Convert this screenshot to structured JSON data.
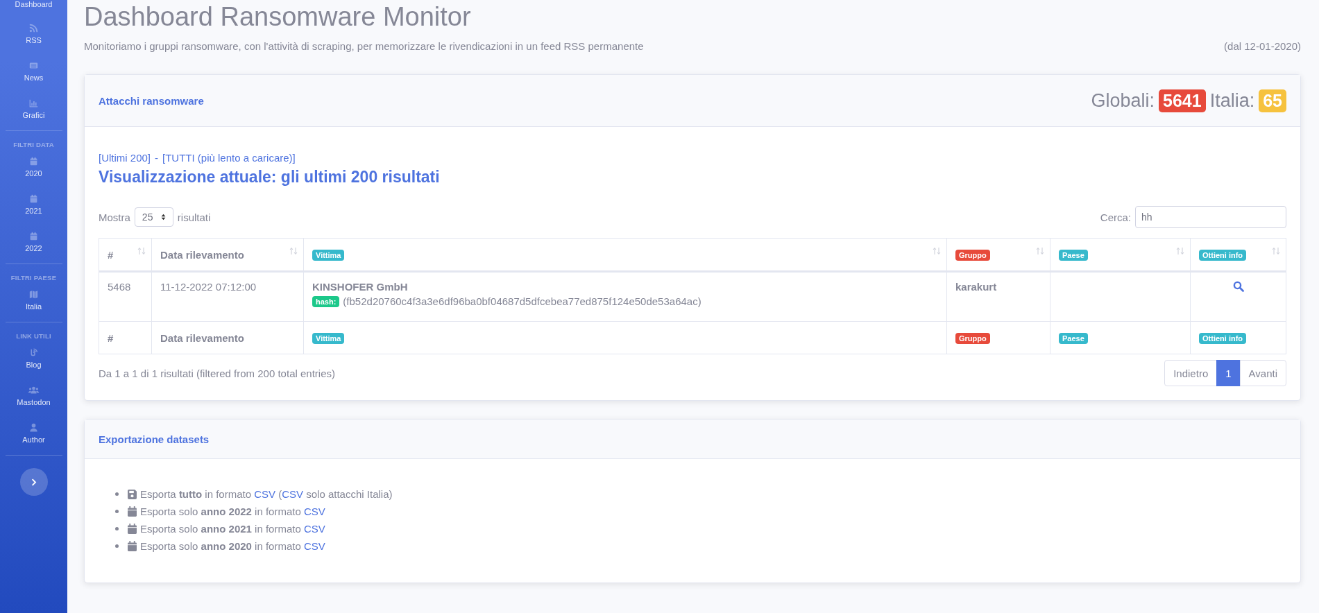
{
  "sidebar": {
    "sections": [
      {
        "items": [
          {
            "label": "Dashboard"
          },
          {
            "label": "RSS",
            "kind": "rss"
          },
          {
            "label": "News",
            "kind": "news"
          },
          {
            "label": "Grafici",
            "kind": "chart"
          }
        ]
      },
      {
        "heading": "FILTRI DATA",
        "items": [
          {
            "label": "2020",
            "kind": "calendar"
          },
          {
            "label": "2021",
            "kind": "calendar"
          },
          {
            "label": "2022",
            "kind": "calendar"
          }
        ]
      },
      {
        "heading": "FILTRI PAESE",
        "items": [
          {
            "label": "Italia",
            "kind": "map"
          }
        ]
      },
      {
        "heading": "LINK UTILI",
        "items": [
          {
            "label": "Blog",
            "kind": "blog"
          },
          {
            "label": "Mastodon",
            "kind": "users"
          },
          {
            "label": "Author",
            "kind": "user"
          }
        ]
      }
    ]
  },
  "page": {
    "title": "Dashboard Ransomware Monitor",
    "subtitle": "Monitoriamo i gruppi ransomware, con l'attività di scraping, per memorizzare le rivendicazioni in un feed RSS permanente",
    "since": "(dal 12-01-2020)"
  },
  "attacks_card": {
    "title": "Attacchi ransomware",
    "counters": [
      {
        "label": "Globali:",
        "value": "5641",
        "color": "#e74a3b"
      },
      {
        "label": "Italia:",
        "value": "65",
        "color": "#f6c23e"
      }
    ],
    "view_links": [
      "[Ultimi 200]",
      "[TUTTI (più lento a caricare)]"
    ],
    "view_links_separator": "-",
    "view_heading": "Visualizzazione attuale: gli ultimi 200 risultati",
    "length": {
      "before": "Mostra",
      "value": "25",
      "after": "risultati"
    },
    "search": {
      "label": "Cerca:",
      "value": "hh"
    },
    "table": {
      "columns": [
        {
          "label": "#",
          "kind": "text"
        },
        {
          "label": "Data rilevamento",
          "kind": "text"
        },
        {
          "label": "Vittima",
          "kind": "badge",
          "color": "#36b9cc"
        },
        {
          "label": "Gruppo",
          "kind": "badge",
          "color": "#e74a3b"
        },
        {
          "label": "Paese",
          "kind": "badge",
          "color": "#36b9cc"
        },
        {
          "label": "Ottieni info",
          "kind": "badge",
          "color": "#36b9cc"
        }
      ],
      "footer_columns": [
        {
          "label": "#",
          "kind": "text"
        },
        {
          "label": "Data rilevamento",
          "kind": "text"
        },
        {
          "label": "Vittima",
          "kind": "badge",
          "color": "#36b9cc"
        },
        {
          "label": "Gruppo",
          "kind": "badge",
          "color": "#e74a3b"
        },
        {
          "label": "Paese",
          "kind": "badge",
          "color": "#36b9cc"
        },
        {
          "label": "Ottieni info",
          "kind": "badge",
          "color": "#36b9cc"
        }
      ],
      "rows": [
        {
          "id": "5468",
          "date": "11-12-2022 07:12:00",
          "victim": "KINSHOFER GmbH",
          "hash_label": "hash:",
          "hash": "(fb52d20760c4f3a3e6df96ba0bf04687d5dfcebea77ed875f124e50de53a64ac)",
          "group": "karakurt"
        }
      ]
    },
    "info": "Da 1 a 1 di 1 risultati (filtered from 200 total entries)",
    "pages": [
      {
        "label": "Indietro",
        "selected": false
      },
      {
        "label": "1",
        "selected": true
      },
      {
        "label": "Avanti",
        "selected": false
      }
    ]
  },
  "export_card": {
    "title": "Exportazione datasets",
    "items": [
      {
        "kind": "save",
        "parts": [
          {
            "kind": "text",
            "text": "Esporta **tutto** in formato "
          },
          {
            "kind": "link",
            "text": "CSV"
          },
          {
            "kind": "text",
            "text": " ("
          },
          {
            "kind": "link",
            "text": "CSV"
          },
          {
            "kind": "text",
            "text": " solo attacchi Italia)"
          }
        ]
      },
      {
        "kind": "calendar",
        "parts": [
          {
            "kind": "text",
            "text": "Esporta solo **anno 2022** in formato "
          },
          {
            "kind": "link",
            "text": "CSV"
          }
        ]
      },
      {
        "kind": "calendar",
        "parts": [
          {
            "kind": "text",
            "text": "Esporta solo **anno 2021** in formato "
          },
          {
            "kind": "link",
            "text": "CSV"
          }
        ]
      },
      {
        "kind": "calendar",
        "parts": [
          {
            "kind": "text",
            "text": "Esporta solo **anno 2020** in formato "
          },
          {
            "kind": "link",
            "text": "CSV"
          }
        ]
      }
    ]
  }
}
